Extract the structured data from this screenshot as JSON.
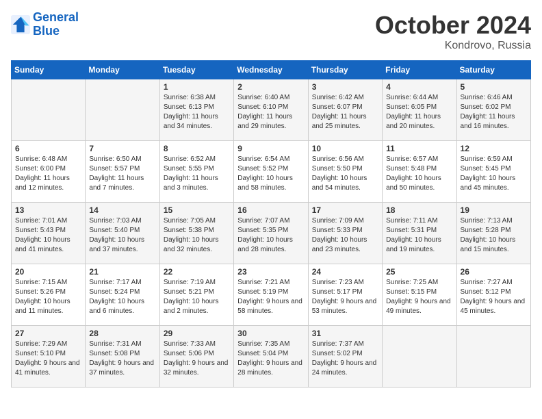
{
  "header": {
    "logo_line1": "General",
    "logo_line2": "Blue",
    "month_year": "October 2024",
    "location": "Kondrovo, Russia"
  },
  "days_of_week": [
    "Sunday",
    "Monday",
    "Tuesday",
    "Wednesday",
    "Thursday",
    "Friday",
    "Saturday"
  ],
  "weeks": [
    [
      {
        "day": "",
        "sunrise": "",
        "sunset": "",
        "daylight": ""
      },
      {
        "day": "",
        "sunrise": "",
        "sunset": "",
        "daylight": ""
      },
      {
        "day": "1",
        "sunrise": "Sunrise: 6:38 AM",
        "sunset": "Sunset: 6:13 PM",
        "daylight": "Daylight: 11 hours and 34 minutes."
      },
      {
        "day": "2",
        "sunrise": "Sunrise: 6:40 AM",
        "sunset": "Sunset: 6:10 PM",
        "daylight": "Daylight: 11 hours and 29 minutes."
      },
      {
        "day": "3",
        "sunrise": "Sunrise: 6:42 AM",
        "sunset": "Sunset: 6:07 PM",
        "daylight": "Daylight: 11 hours and 25 minutes."
      },
      {
        "day": "4",
        "sunrise": "Sunrise: 6:44 AM",
        "sunset": "Sunset: 6:05 PM",
        "daylight": "Daylight: 11 hours and 20 minutes."
      },
      {
        "day": "5",
        "sunrise": "Sunrise: 6:46 AM",
        "sunset": "Sunset: 6:02 PM",
        "daylight": "Daylight: 11 hours and 16 minutes."
      }
    ],
    [
      {
        "day": "6",
        "sunrise": "Sunrise: 6:48 AM",
        "sunset": "Sunset: 6:00 PM",
        "daylight": "Daylight: 11 hours and 12 minutes."
      },
      {
        "day": "7",
        "sunrise": "Sunrise: 6:50 AM",
        "sunset": "Sunset: 5:57 PM",
        "daylight": "Daylight: 11 hours and 7 minutes."
      },
      {
        "day": "8",
        "sunrise": "Sunrise: 6:52 AM",
        "sunset": "Sunset: 5:55 PM",
        "daylight": "Daylight: 11 hours and 3 minutes."
      },
      {
        "day": "9",
        "sunrise": "Sunrise: 6:54 AM",
        "sunset": "Sunset: 5:52 PM",
        "daylight": "Daylight: 10 hours and 58 minutes."
      },
      {
        "day": "10",
        "sunrise": "Sunrise: 6:56 AM",
        "sunset": "Sunset: 5:50 PM",
        "daylight": "Daylight: 10 hours and 54 minutes."
      },
      {
        "day": "11",
        "sunrise": "Sunrise: 6:57 AM",
        "sunset": "Sunset: 5:48 PM",
        "daylight": "Daylight: 10 hours and 50 minutes."
      },
      {
        "day": "12",
        "sunrise": "Sunrise: 6:59 AM",
        "sunset": "Sunset: 5:45 PM",
        "daylight": "Daylight: 10 hours and 45 minutes."
      }
    ],
    [
      {
        "day": "13",
        "sunrise": "Sunrise: 7:01 AM",
        "sunset": "Sunset: 5:43 PM",
        "daylight": "Daylight: 10 hours and 41 minutes."
      },
      {
        "day": "14",
        "sunrise": "Sunrise: 7:03 AM",
        "sunset": "Sunset: 5:40 PM",
        "daylight": "Daylight: 10 hours and 37 minutes."
      },
      {
        "day": "15",
        "sunrise": "Sunrise: 7:05 AM",
        "sunset": "Sunset: 5:38 PM",
        "daylight": "Daylight: 10 hours and 32 minutes."
      },
      {
        "day": "16",
        "sunrise": "Sunrise: 7:07 AM",
        "sunset": "Sunset: 5:35 PM",
        "daylight": "Daylight: 10 hours and 28 minutes."
      },
      {
        "day": "17",
        "sunrise": "Sunrise: 7:09 AM",
        "sunset": "Sunset: 5:33 PM",
        "daylight": "Daylight: 10 hours and 23 minutes."
      },
      {
        "day": "18",
        "sunrise": "Sunrise: 7:11 AM",
        "sunset": "Sunset: 5:31 PM",
        "daylight": "Daylight: 10 hours and 19 minutes."
      },
      {
        "day": "19",
        "sunrise": "Sunrise: 7:13 AM",
        "sunset": "Sunset: 5:28 PM",
        "daylight": "Daylight: 10 hours and 15 minutes."
      }
    ],
    [
      {
        "day": "20",
        "sunrise": "Sunrise: 7:15 AM",
        "sunset": "Sunset: 5:26 PM",
        "daylight": "Daylight: 10 hours and 11 minutes."
      },
      {
        "day": "21",
        "sunrise": "Sunrise: 7:17 AM",
        "sunset": "Sunset: 5:24 PM",
        "daylight": "Daylight: 10 hours and 6 minutes."
      },
      {
        "day": "22",
        "sunrise": "Sunrise: 7:19 AM",
        "sunset": "Sunset: 5:21 PM",
        "daylight": "Daylight: 10 hours and 2 minutes."
      },
      {
        "day": "23",
        "sunrise": "Sunrise: 7:21 AM",
        "sunset": "Sunset: 5:19 PM",
        "daylight": "Daylight: 9 hours and 58 minutes."
      },
      {
        "day": "24",
        "sunrise": "Sunrise: 7:23 AM",
        "sunset": "Sunset: 5:17 PM",
        "daylight": "Daylight: 9 hours and 53 minutes."
      },
      {
        "day": "25",
        "sunrise": "Sunrise: 7:25 AM",
        "sunset": "Sunset: 5:15 PM",
        "daylight": "Daylight: 9 hours and 49 minutes."
      },
      {
        "day": "26",
        "sunrise": "Sunrise: 7:27 AM",
        "sunset": "Sunset: 5:12 PM",
        "daylight": "Daylight: 9 hours and 45 minutes."
      }
    ],
    [
      {
        "day": "27",
        "sunrise": "Sunrise: 7:29 AM",
        "sunset": "Sunset: 5:10 PM",
        "daylight": "Daylight: 9 hours and 41 minutes."
      },
      {
        "day": "28",
        "sunrise": "Sunrise: 7:31 AM",
        "sunset": "Sunset: 5:08 PM",
        "daylight": "Daylight: 9 hours and 37 minutes."
      },
      {
        "day": "29",
        "sunrise": "Sunrise: 7:33 AM",
        "sunset": "Sunset: 5:06 PM",
        "daylight": "Daylight: 9 hours and 32 minutes."
      },
      {
        "day": "30",
        "sunrise": "Sunrise: 7:35 AM",
        "sunset": "Sunset: 5:04 PM",
        "daylight": "Daylight: 9 hours and 28 minutes."
      },
      {
        "day": "31",
        "sunrise": "Sunrise: 7:37 AM",
        "sunset": "Sunset: 5:02 PM",
        "daylight": "Daylight: 9 hours and 24 minutes."
      },
      {
        "day": "",
        "sunrise": "",
        "sunset": "",
        "daylight": ""
      },
      {
        "day": "",
        "sunrise": "",
        "sunset": "",
        "daylight": ""
      }
    ]
  ]
}
